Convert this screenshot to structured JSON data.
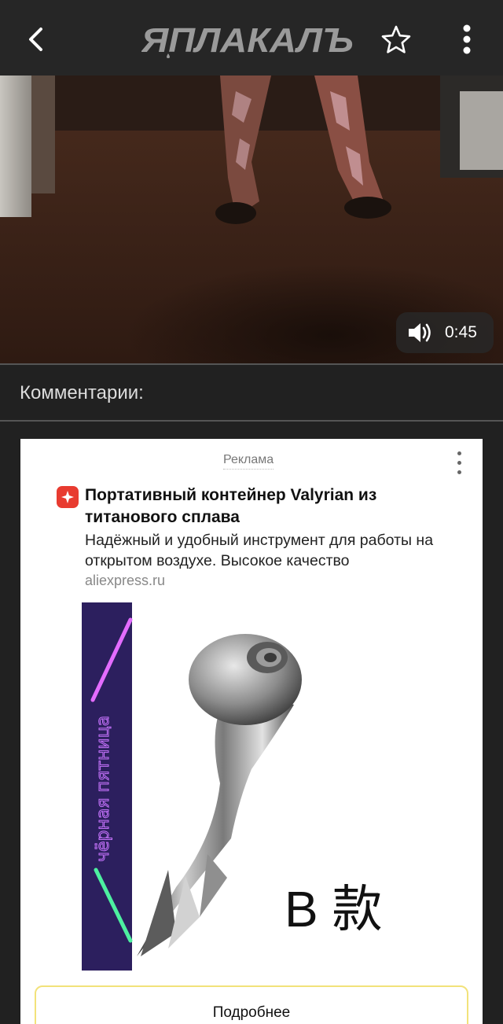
{
  "header": {
    "logo_text": "ЯПЛАКАЛЪ",
    "back_icon": "chevron-left-icon",
    "favorite_icon": "star-icon",
    "menu_icon": "more-vertical-icon"
  },
  "video": {
    "volume_icon": "volume-icon",
    "duration": "0:45"
  },
  "comments": {
    "title": "Комментарии:"
  },
  "ad": {
    "label": "Реклама",
    "title": "Портативный контейнер Valyrian из титанового сплава",
    "description": "Надёжный и удобный инструмент для работы на открытом воздухе. Высокое качество",
    "domain": "aliexpress.ru",
    "banner_text": "чёрная пятница",
    "variant_label": "B 款",
    "button_label": "Подробнее"
  },
  "colors": {
    "background": "#212121",
    "topbar": "#262626",
    "ad_icon": "#e83b30",
    "button_border": "#f2e27a"
  }
}
